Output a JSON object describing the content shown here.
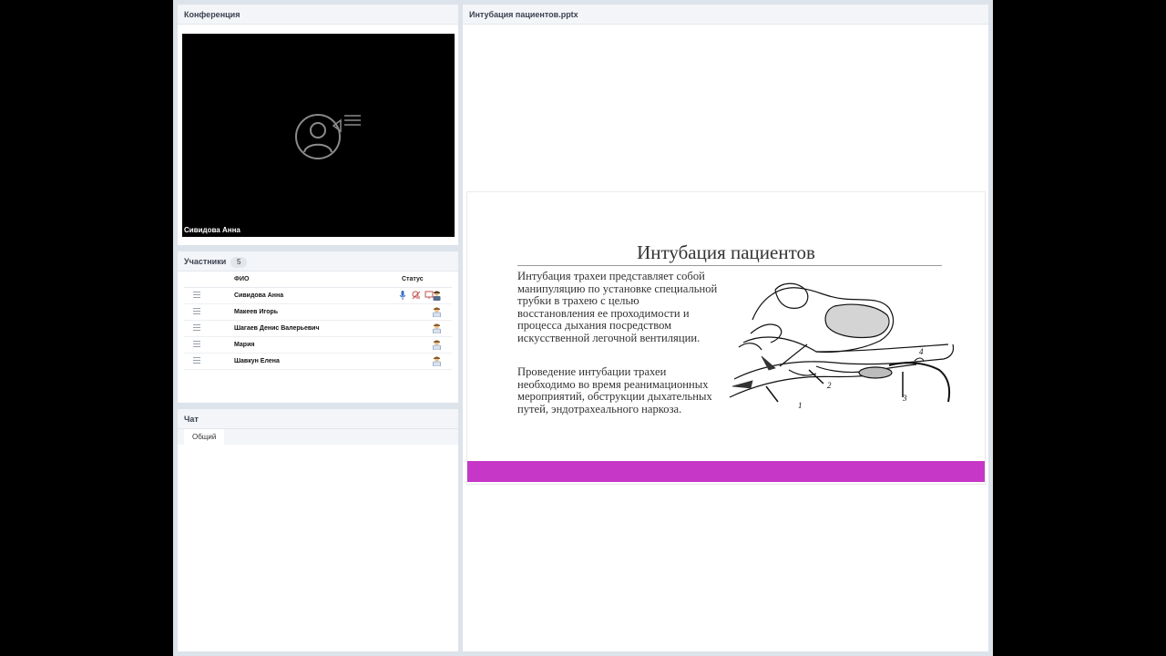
{
  "conference": {
    "title": "Конференция",
    "video_name": "Сивидова Анна"
  },
  "participants": {
    "title": "Участники",
    "count": "5",
    "col_name": "ФИО",
    "col_status": "Статус",
    "rows": [
      {
        "name": "Сивидова Анна"
      },
      {
        "name": "Макеев Игорь"
      },
      {
        "name": "Шагаев Денис Валерьевич"
      },
      {
        "name": "Мария"
      },
      {
        "name": "Шавкун Елена"
      }
    ]
  },
  "chat": {
    "title": "Чат",
    "tab": "Общий"
  },
  "presentation": {
    "title": "Интубация пациентов.pptx",
    "slide_title": "Интубация пациентов",
    "paragraph1": "Интубация трахеи представляет собой манипуляцию по установке специальной трубки в трахею с целью восстановления ее проходимости и процесса дыхания посредством искусственной легочной вентиляции.",
    "paragraph2": "Проведение интубации трахеи необходимо во время реанимационных мероприятий, обструкции дыхательных путей, эндотрахеального наркоза.",
    "figure_labels": [
      "1",
      "2",
      "3",
      "4"
    ],
    "accent_color": "#c737c7"
  }
}
